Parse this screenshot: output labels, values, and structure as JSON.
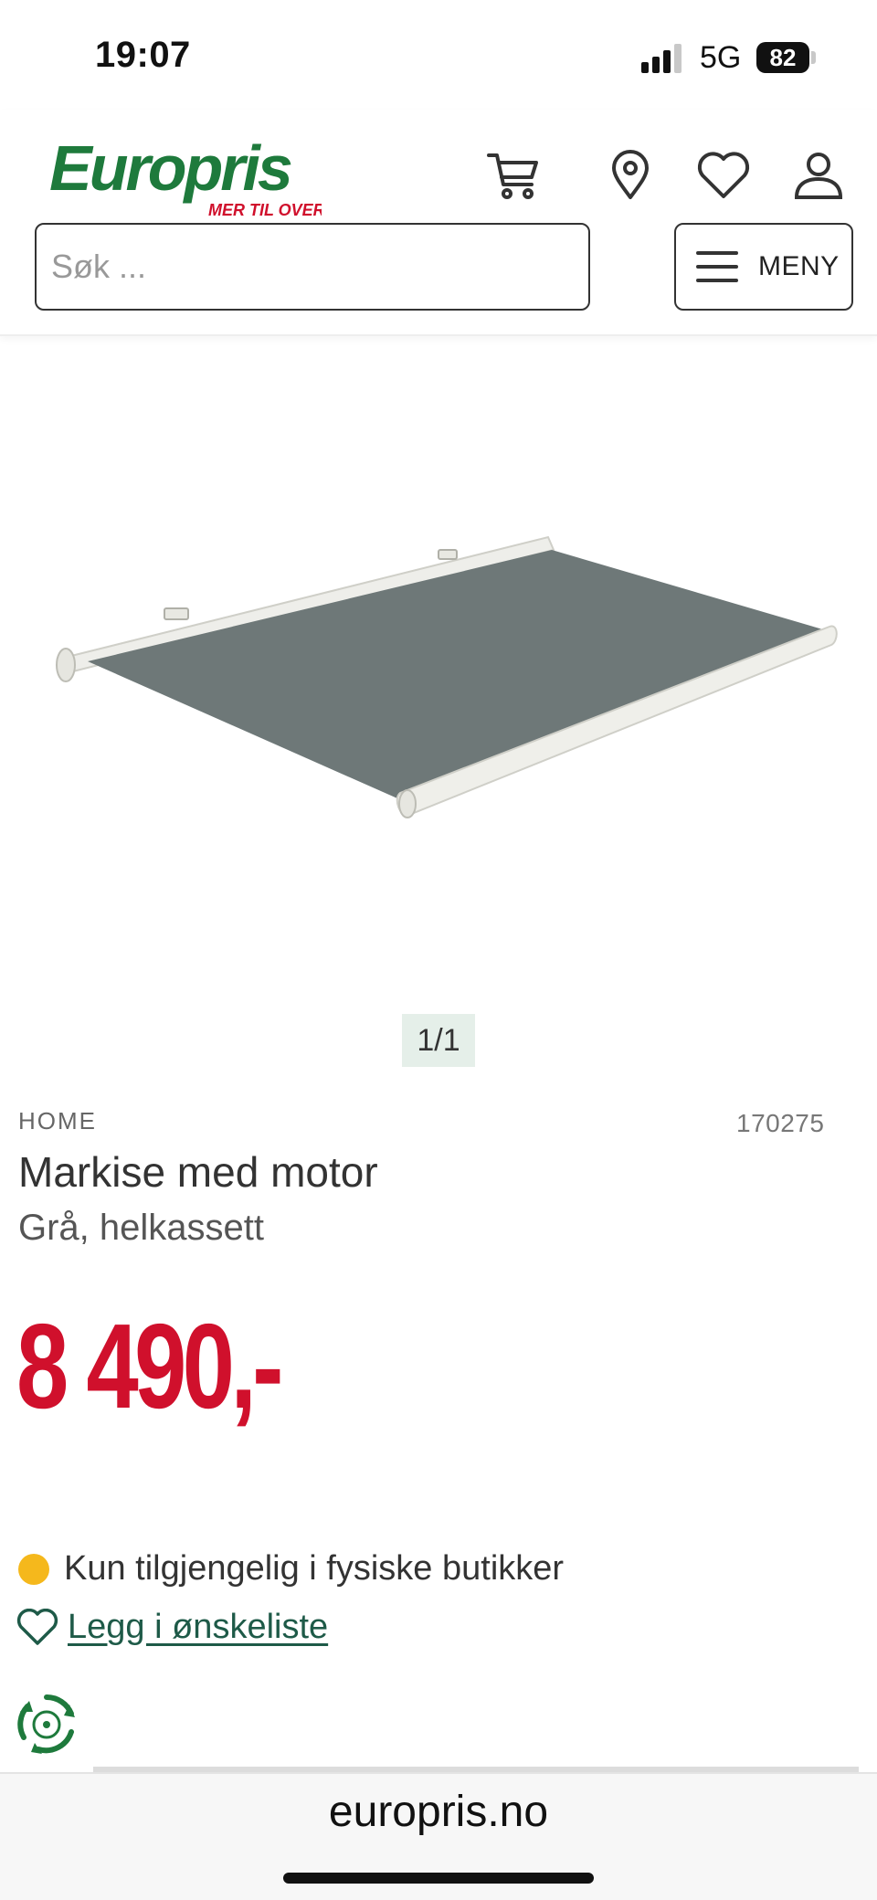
{
  "status_bar": {
    "time": "19:07",
    "network": "5G",
    "battery": "82"
  },
  "header": {
    "logo_text": "Europris",
    "logo_tagline": "MER TIL OVERS",
    "search_placeholder": "Søk ...",
    "menu_label": "MENY",
    "icons": [
      "cart-icon",
      "location-pin-icon",
      "heart-icon",
      "user-icon",
      "hamburger-icon"
    ]
  },
  "gallery": {
    "counter": "1/1"
  },
  "product": {
    "brand": "HOME",
    "sku": "170275",
    "title": "Markise med motor",
    "variant": "Grå, helkassett",
    "price": "8 490,-",
    "availability": "Kun tilgjengelig i fysiske butikker",
    "wishlist_label": "Legg i ønskeliste"
  },
  "colors": {
    "brand_green": "#1e7a3c",
    "brand_red": "#d0102c",
    "price_red": "#d0102c",
    "availability_dot": "#f5b81c",
    "link_green": "#1e5a48"
  },
  "browser": {
    "url": "europris.no"
  }
}
